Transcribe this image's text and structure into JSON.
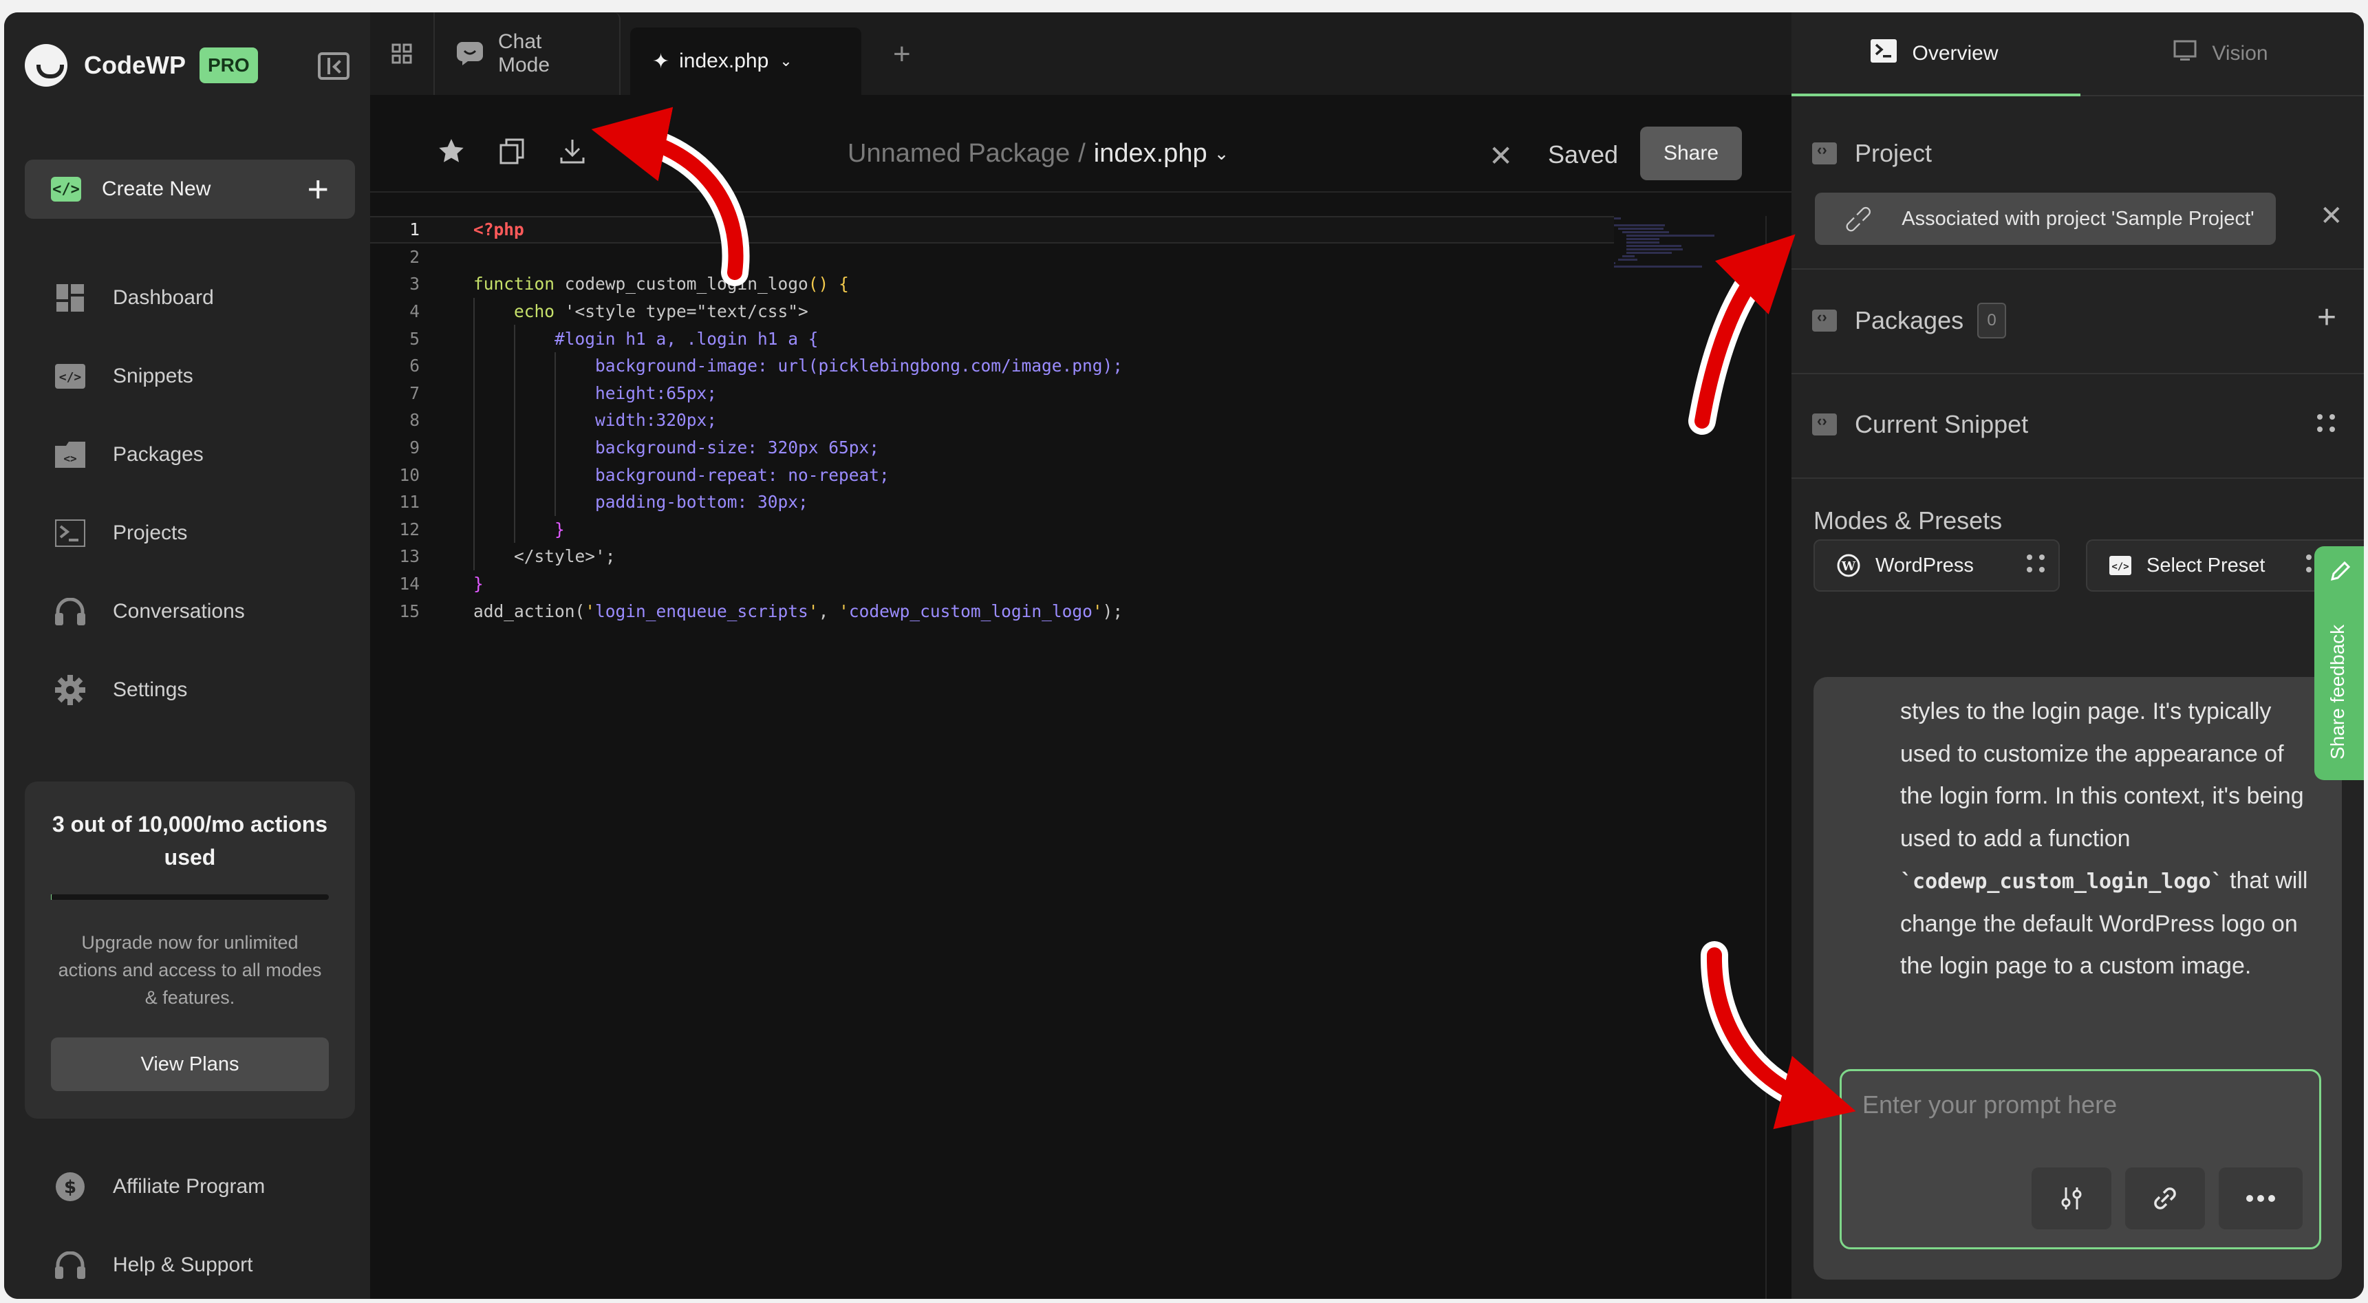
{
  "brand": {
    "name": "CodeWP",
    "badge": "PRO"
  },
  "sidebar": {
    "create_new": "Create New",
    "items": [
      {
        "label": "Dashboard",
        "icon": "dashboard-icon"
      },
      {
        "label": "Snippets",
        "icon": "code-icon"
      },
      {
        "label": "Packages",
        "icon": "package-icon"
      },
      {
        "label": "Projects",
        "icon": "terminal-icon"
      },
      {
        "label": "Conversations",
        "icon": "headset-icon"
      },
      {
        "label": "Settings",
        "icon": "gear-icon"
      }
    ],
    "usage": {
      "title": "3 out of 10,000/mo actions used",
      "description": "Upgrade now for unlimited actions and access to all modes & features.",
      "button": "View Plans",
      "progress": 0.0003
    },
    "bottom_items": [
      {
        "label": "Affiliate Program",
        "icon": "dollar-icon"
      },
      {
        "label": "Help & Support",
        "icon": "headset-icon"
      }
    ]
  },
  "tabs": {
    "chat_mode": "Chat Mode",
    "file": "index.php"
  },
  "toolbar": {
    "package": "Unnamed Package",
    "separator": "/",
    "file": "index.php",
    "status": "Saved",
    "share": "Share"
  },
  "editor": {
    "lines": [
      "<?php",
      "",
      "function codewp_custom_login_logo() {",
      "    echo '<style type=\"text/css\">",
      "        #login h1 a, .login h1 a {",
      "            background-image: url(picklebingbong.com/image.png);",
      "            height:65px;",
      "            width:320px;",
      "            background-size: 320px 65px;",
      "            background-repeat: no-repeat;",
      "            padding-bottom: 30px;",
      "        }",
      "    </style>';",
      "}",
      "add_action('login_enqueue_scripts', 'codewp_custom_login_logo');"
    ]
  },
  "right": {
    "tabs": {
      "overview": "Overview",
      "vision": "Vision"
    },
    "project": {
      "title": "Project",
      "associated": "Associated with project 'Sample Project'"
    },
    "packages": {
      "title": "Packages",
      "count": "0"
    },
    "current_snippet": {
      "title": "Current Snippet"
    },
    "modes": {
      "title": "Modes & Presets",
      "mode": "WordPress",
      "preset": "Select Preset"
    },
    "feedback": "Share feedback",
    "chat": {
      "p1": "styles to the login page. It's typically used to customize the appearance of the login form. In this context, it's being used to add a function ",
      "code": "`codewp_custom_login_logo`",
      "p2": " that will change the default WordPress logo on the login page to a custom image."
    },
    "prompt_placeholder": "Enter your prompt here"
  },
  "colors": {
    "accent": "#7fd88a",
    "arrow": "#e00000"
  }
}
